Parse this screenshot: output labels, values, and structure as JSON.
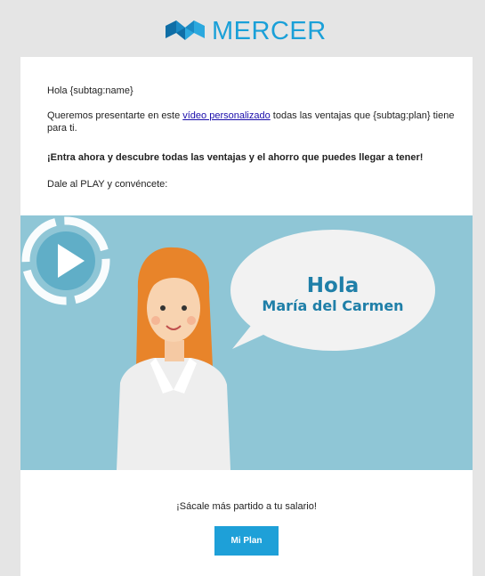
{
  "header": {
    "logo_text": "MERCER",
    "logo_icon": "mercer-logo-icon"
  },
  "email": {
    "greeting": "Hola {subtag:name}",
    "intro_before_link": "Queremos presentarte en este ",
    "intro_link": "vídeo personalizado",
    "intro_after_link": " todas las ventajas que {subtag:plan} tiene para ti.",
    "emphasis": "¡Entra ahora y descubre todas las ventajas y el ahorro que puedes llegar a tener!",
    "prompt": "Dale al PLAY y convéncete:"
  },
  "video": {
    "bubble_line1": "Hola",
    "bubble_line2": "María del Carmen",
    "play_icon": "play-icon",
    "background_color": "#8fc6d6"
  },
  "cta": {
    "tagline": "¡Sácale más partido a tu salario!",
    "button_label": "Mi Plan",
    "button_color": "#1ea0d8"
  },
  "colors": {
    "brand": "#1aa0d8",
    "link": "#1a0dab"
  }
}
